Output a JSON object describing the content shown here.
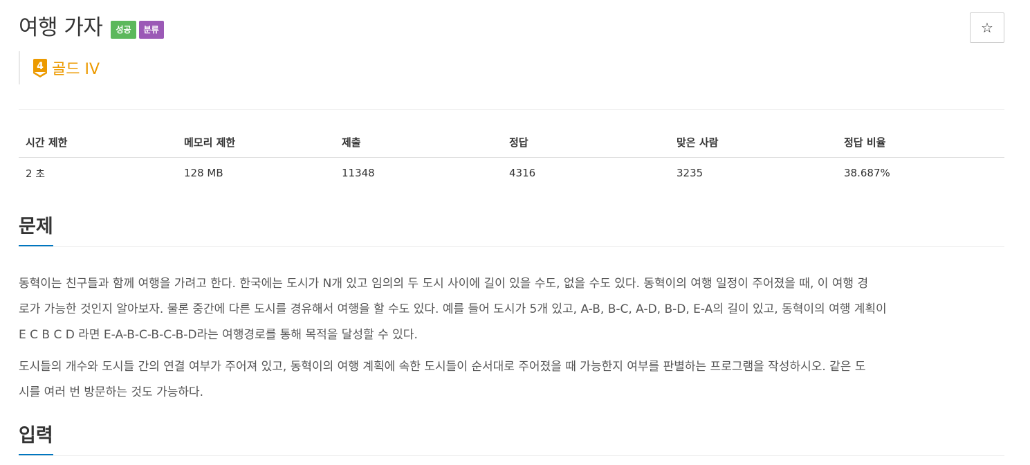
{
  "problem": {
    "title": "여행 가자",
    "badges": [
      {
        "label": "성공",
        "color": "#5cb85c"
      },
      {
        "label": "분류",
        "color": "#9b59b6"
      }
    ],
    "tier": {
      "level": "4",
      "label": "골드 IV",
      "color": "#ec9a00"
    },
    "star_icon": "☆"
  },
  "stats": {
    "headers": [
      "시간 제한",
      "메모리 제한",
      "제출",
      "정답",
      "맞은 사람",
      "정답 비율"
    ],
    "values": [
      "2 초",
      "128 MB",
      "11348",
      "4316",
      "3235",
      "38.687%"
    ]
  },
  "sections": {
    "problem_title": "문제",
    "paragraph1_line1": "동혁이는 친구들과 함께 여행을 가려고 한다. 한국에는 도시가 N개 있고 임의의 두 도시 사이에 길이 있을 수도, 없을 수도 있다. 동혁이의 여행 일정이 주어졌을 때, 이 여행 경",
    "paragraph1_line2": "로가 가능한 것인지 알아보자. 물론 중간에 다른 도시를 경유해서 여행을 할 수도 있다. 예를 들어 도시가 5개 있고, A-B, B-C, A-D, B-D, E-A의 길이 있고, 동혁이의 여행 계획이",
    "paragraph1_line3": "E C B C D 라면 E-A-B-C-B-C-B-D라는 여행경로를 통해 목적을 달성할 수 있다.",
    "paragraph2_line1": "도시들의 개수와 도시들 간의 연결 여부가 주어져 있고, 동혁이의 여행 계획에 속한 도시들이 순서대로 주어졌을 때 가능한지 여부를 판별하는 프로그램을 작성하시오. 같은 도",
    "paragraph2_line2": "시를 여러 번 방문하는 것도 가능하다.",
    "input_title": "입력"
  }
}
